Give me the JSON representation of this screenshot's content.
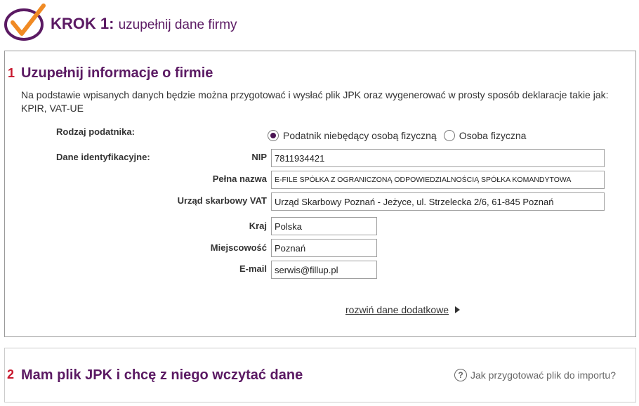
{
  "header": {
    "step_label": "KROK 1:",
    "step_text": "uzupełnij dane firmy"
  },
  "section1": {
    "number": "1",
    "title": "Uzupełnij informacje o firmie",
    "description": "Na podstawie wpisanych danych będzie można przygotować i wysłać plik JPK oraz wygenerować w prosty sposób deklaracje takie jak: KPIR, VAT-UE",
    "taxpayer_type_label": "Rodzaj podatnika:",
    "taxpayer_options": [
      {
        "label": "Podatnik niebędący osobą fizyczną",
        "selected": true
      },
      {
        "label": "Osoba fizyczna",
        "selected": false
      }
    ],
    "identification_label": "Dane identyfikacyjne:",
    "fields": {
      "nip": {
        "label": "NIP",
        "value": "7811934421"
      },
      "full_name": {
        "label": "Pełna nazwa",
        "value": "E-FILE SPÓŁKA Z OGRANICZONĄ ODPOWIEDZIALNOŚCIĄ SPÓŁKA KOMANDYTOWA"
      },
      "tax_office": {
        "label": "Urząd skarbowy VAT",
        "value": "Urząd Skarbowy Poznań - Jeżyce, ul. Strzelecka 2/6, 61-845 Poznań"
      },
      "country": {
        "label": "Kraj",
        "value": "Polska"
      },
      "city": {
        "label": "Miejscowość",
        "value": "Poznań"
      },
      "email": {
        "label": "E-mail",
        "value": "serwis@fillup.pl"
      }
    },
    "expand_link": "rozwiń dane dodatkowe"
  },
  "section2": {
    "number": "2",
    "title": "Mam plik JPK i chcę z niego wczytać dane",
    "help_link": "Jak przygotować plik do importu?"
  },
  "colors": {
    "brand_purple": "#5b1a63",
    "accent_red": "#c8192e",
    "logo_orange": "#f08a24"
  }
}
